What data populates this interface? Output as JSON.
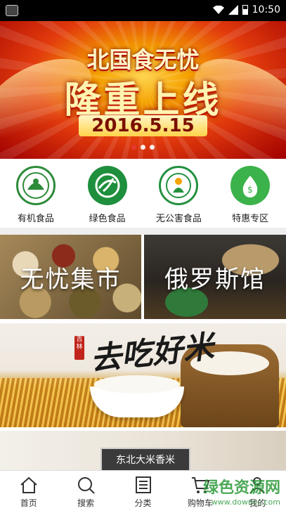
{
  "status_bar": {
    "time": "10:50"
  },
  "banner": {
    "subtitle": "北国食无忧",
    "title": "隆重上线",
    "date": "2016.5.15",
    "page_dots": 3,
    "active_dot": 0
  },
  "categories": [
    {
      "label": "有机食品",
      "icon": "organic-food-icon",
      "color": "#2e8b3a"
    },
    {
      "label": "绿色食品",
      "icon": "green-food-icon",
      "color": "#1e8f3c"
    },
    {
      "label": "无公害食品",
      "icon": "pollution-free-icon",
      "color": "#23913f"
    },
    {
      "label": "特惠专区",
      "icon": "discount-zone-icon",
      "color": "#3bb24a"
    }
  ],
  "feature_tiles": {
    "left": "无忧集市",
    "right": "俄罗斯馆"
  },
  "rice_banner": {
    "seal_text": "吉林",
    "title": "去吃好米"
  },
  "promo": {
    "label": "东北大米香米"
  },
  "tabbar": {
    "items": [
      {
        "label": "首页",
        "icon": "home-icon"
      },
      {
        "label": "搜索",
        "icon": "search-icon"
      },
      {
        "label": "分类",
        "icon": "category-icon"
      },
      {
        "label": "购物车",
        "icon": "cart-icon"
      },
      {
        "label": "我的",
        "icon": "user-icon"
      }
    ]
  },
  "watermark": {
    "main": "绿色资源网",
    "url": "www.downcc.com"
  },
  "colors": {
    "accent_green": "#2e8b3a",
    "banner_red": "#e23b0d",
    "active_dot": "#e53935"
  }
}
